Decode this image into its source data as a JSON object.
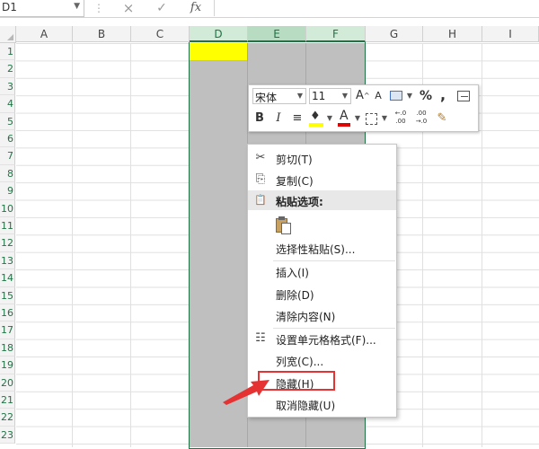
{
  "formula_bar": {
    "name_box": "D1",
    "separator_icon": "vertical-dots-icon",
    "cancel_icon": "×",
    "enter_icon": "✓",
    "fx_label": "fx"
  },
  "columns": [
    "A",
    "B",
    "C",
    "D",
    "E",
    "F",
    "G",
    "H",
    "I"
  ],
  "selected_columns": [
    "D",
    "E",
    "F"
  ],
  "rows": [
    "1",
    "2",
    "3",
    "4",
    "5",
    "6",
    "7",
    "8",
    "9",
    "10",
    "11",
    "12",
    "13",
    "14",
    "15",
    "16",
    "17",
    "18",
    "19",
    "20",
    "21",
    "22",
    "23"
  ],
  "colors": {
    "selection": "#217346",
    "cell_d1_fill": "#ffff00",
    "highlight": "#e53333",
    "fill_color": "#ffff00",
    "font_color": "#e00000"
  },
  "mini_toolbar": {
    "font_name": "宋体",
    "font_size": "11",
    "grow_font": "A",
    "grow_font_sup": "^",
    "shrink_font": "A",
    "percent": "%",
    "comma": ",",
    "bold": "B",
    "italic": "I",
    "align": "≡",
    "fill_glyph": "♦",
    "font_color_glyph": "A",
    "increase_decimal": "←.0\n.00",
    "decrease_decimal": ".00\n→.0",
    "painter_glyph": "✎"
  },
  "context_menu": {
    "items": [
      {
        "label": "剪切(T)",
        "icon": "scissors-icon",
        "glyph": "✂"
      },
      {
        "label": "复制(C)",
        "icon": "copy-icon",
        "glyph": "⎘"
      },
      {
        "label": "粘贴选项:",
        "icon": "paste-icon",
        "glyph": "📋"
      },
      {
        "label": "选择性粘贴(S)..."
      },
      {
        "label": "插入(I)"
      },
      {
        "label": "删除(D)"
      },
      {
        "label": "清除内容(N)"
      },
      {
        "label": "设置单元格格式(F)...",
        "icon": "format-cells-icon",
        "glyph": "☷"
      },
      {
        "label": "列宽(C)..."
      },
      {
        "label": "隐藏(H)"
      },
      {
        "label": "取消隐藏(U)"
      }
    ]
  }
}
